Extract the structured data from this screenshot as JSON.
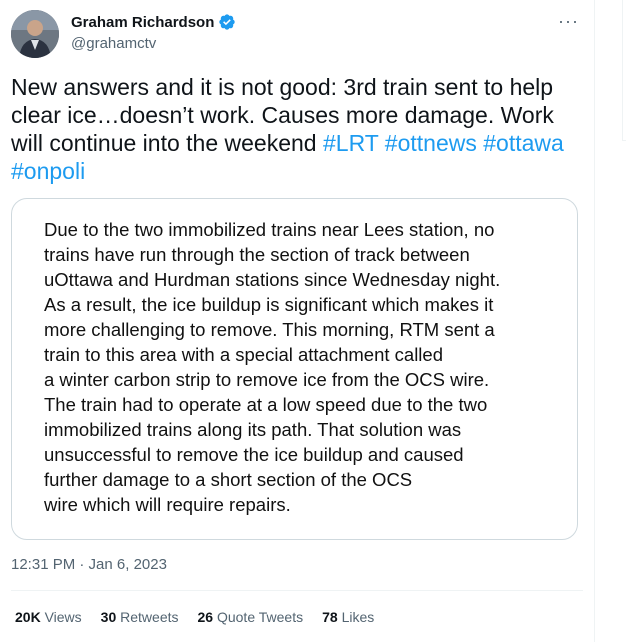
{
  "author": {
    "name": "Graham Richardson",
    "handle": "@grahamctv"
  },
  "tweet": {
    "text_part1": "New answers and it is not good: 3rd train sent to help clear ice…doesn’t work. Causes more damage. Work will continue into the weekend ",
    "hashtags": [
      "#LRT",
      "#ottnews",
      "#ottawa",
      "#onpoli"
    ],
    "timestamp": "12:31 PM · Jan 6, 2023"
  },
  "media": {
    "text": "Due to the two immobilized trains near Lees station, no\ntrains have run through the section of track between\nuOttawa and Hurdman stations since Wednesday night.\nAs a result, the ice buildup is significant which makes it\nmore challenging to remove. This morning, RTM sent a\ntrain to this area with a special attachment called\na winter carbon strip to remove ice from the OCS wire.\nThe train had to operate at a low speed due to the two\nimmobilized trains along its path. That solution was\nunsuccessful to remove the ice buildup and caused\nfurther damage to a short section of the OCS\nwire which will require repairs."
  },
  "stats": {
    "views_count": "20K",
    "views_label": "Views",
    "retweets_count": "30",
    "retweets_label": "Retweets",
    "quotes_count": "26",
    "quotes_label": "Quote Tweets",
    "likes_count": "78",
    "likes_label": "Likes"
  },
  "colors": {
    "link": "#1d9bf0",
    "secondary_text": "#536471",
    "verified_badge": "#1d9bf0"
  },
  "icons": [
    "avatar",
    "verified-badge-icon",
    "more-options-icon"
  ]
}
